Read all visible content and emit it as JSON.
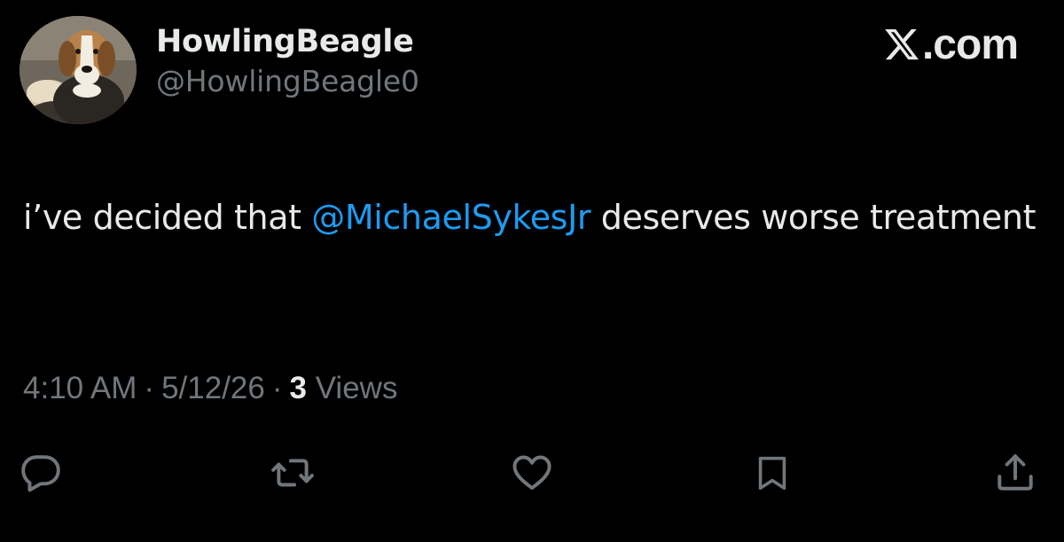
{
  "author": {
    "display_name": "HowlingBeagle",
    "handle": "@HowlingBeagle0"
  },
  "brand": {
    "label": ".com",
    "icon": "x-logo-icon"
  },
  "tweet": {
    "text_before": "i’ve decided that ",
    "mention": "@MichaelSykesJr",
    "text_after": " deserves worse treatment"
  },
  "meta": {
    "time": "4:10 AM",
    "date": "5/12/26",
    "separator": "·",
    "views_count": "3",
    "views_label": "Views"
  },
  "actions": [
    {
      "name": "reply",
      "icon": "reply-icon"
    },
    {
      "name": "repost",
      "icon": "repost-icon"
    },
    {
      "name": "like",
      "icon": "heart-icon"
    },
    {
      "name": "bookmark",
      "icon": "bookmark-icon"
    },
    {
      "name": "share",
      "icon": "share-icon"
    }
  ],
  "colors": {
    "background": "#000000",
    "text_primary": "#e7e9ea",
    "text_secondary": "#71767b",
    "link": "#1d9bf0"
  }
}
